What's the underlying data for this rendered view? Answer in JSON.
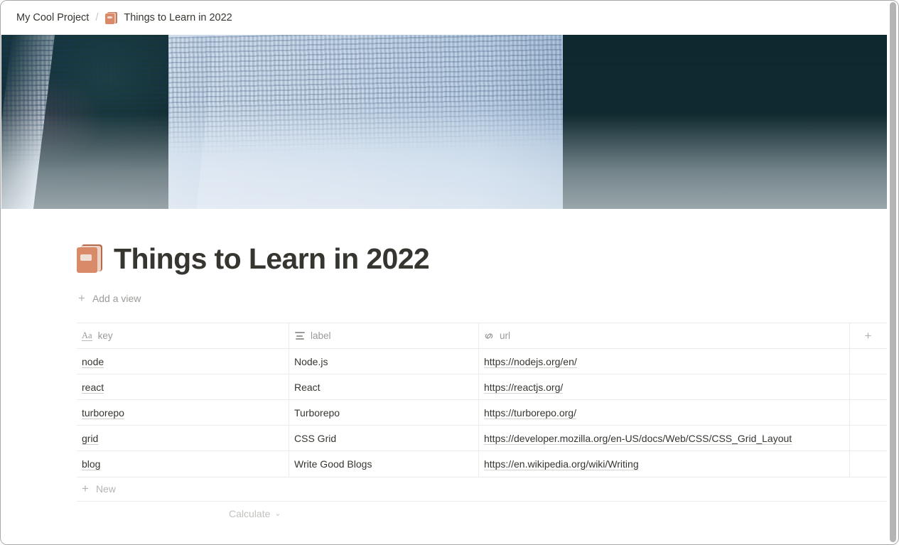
{
  "window": {
    "scrollbar": "vertical-scrollbar"
  },
  "breadcrumb": {
    "workspace": "My Cool Project",
    "separator": "/",
    "page_icon": "closed-book-emoji",
    "page_title": "Things to Learn in 2022"
  },
  "cover": {
    "alt": "open book with blue tinted pages"
  },
  "page": {
    "icon": "closed-book-emoji",
    "title": "Things to Learn in 2022"
  },
  "views": {
    "add_view_plus": "+",
    "add_view_label": "Add a view"
  },
  "table": {
    "columns": [
      {
        "label": "key",
        "type_icon": "title-aa-icon",
        "icon_text": "Aa"
      },
      {
        "label": "label",
        "type_icon": "text-lines-icon",
        "icon_text": ""
      },
      {
        "label": "url",
        "type_icon": "link-icon",
        "icon_text": ""
      }
    ],
    "add_column_label": "+",
    "rows": [
      {
        "key": "node",
        "label": "Node.js",
        "url": "https://nodejs.org/en/"
      },
      {
        "key": "react",
        "label": "React",
        "url": "https://reactjs.org/"
      },
      {
        "key": "turborepo",
        "label": "Turborepo",
        "url": "https://turborepo.org/"
      },
      {
        "key": "grid",
        "label": "CSS Grid",
        "url": "https://developer.mozilla.org/en-US/docs/Web/CSS/CSS_Grid_Layout"
      },
      {
        "key": "blog",
        "label": "Write Good Blogs",
        "url": "https://en.wikipedia.org/wiki/Writing"
      }
    ],
    "new_row_plus": "+",
    "new_row_label": "New",
    "calculate_label": "Calculate",
    "calculate_chevron": "⌄"
  },
  "colors": {
    "text": "#37352f",
    "muted": "#9b9a97",
    "border": "#ecebea",
    "book_spine": "#b56a4d",
    "book_cover": "#d98a68"
  }
}
